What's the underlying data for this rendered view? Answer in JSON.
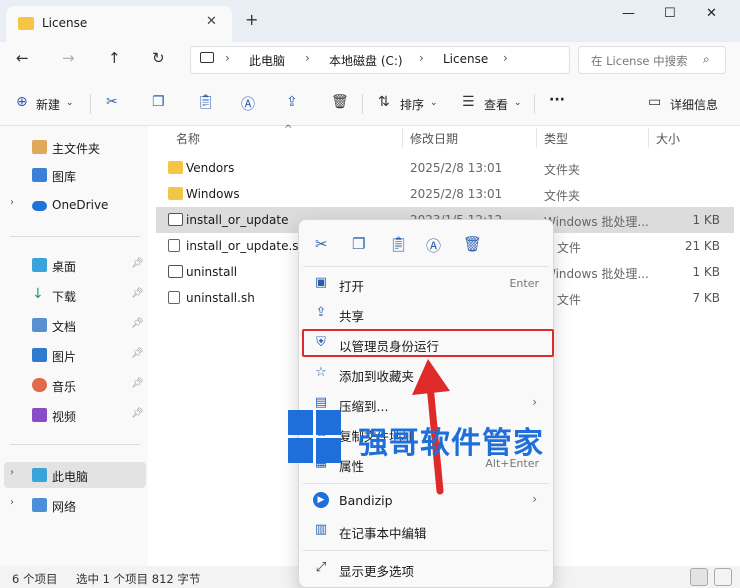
{
  "window": {
    "tab_title": "License",
    "tab_close": "✕",
    "new_tab": "+",
    "minimize": "—",
    "maximize": "☐",
    "close": "✕"
  },
  "nav": {
    "back": "←",
    "forward": "→",
    "up": "↑",
    "refresh": "↻",
    "breadcrumb": [
      "此电脑",
      "本地磁盘 (C:)",
      "License"
    ],
    "search_placeholder": "在 License 中搜索"
  },
  "toolbar": {
    "new_label": "新建",
    "sort_label": "排序",
    "view_label": "查看",
    "more": "···",
    "details_label": "详细信息"
  },
  "sidebar": {
    "items": [
      {
        "label": "主文件夹",
        "icon": "home-icon"
      },
      {
        "label": "图库",
        "icon": "gallery-icon"
      },
      {
        "label": "OneDrive",
        "icon": "cloud-icon"
      },
      {
        "label": "桌面",
        "icon": "desktop-icon"
      },
      {
        "label": "下载",
        "icon": "download-icon"
      },
      {
        "label": "文档",
        "icon": "document-icon"
      },
      {
        "label": "图片",
        "icon": "picture-icon"
      },
      {
        "label": "音乐",
        "icon": "music-icon"
      },
      {
        "label": "视频",
        "icon": "video-icon"
      },
      {
        "label": "此电脑",
        "icon": "computer-icon"
      },
      {
        "label": "网络",
        "icon": "network-icon"
      }
    ]
  },
  "columns": {
    "name": "名称",
    "date": "修改日期",
    "type": "类型",
    "size": "大小"
  },
  "files": [
    {
      "name": "Vendors",
      "date": "2025/2/8 13:01",
      "type": "文件夹",
      "size": ""
    },
    {
      "name": "Windows",
      "date": "2025/2/8 13:01",
      "type": "文件夹",
      "size": ""
    },
    {
      "name": "install_or_update",
      "date": "2023/1/5 12:12",
      "type": "Windows 批处理...",
      "size": "1 KB"
    },
    {
      "name": "install_or_update.sh",
      "date": "",
      "type": "H 文件",
      "size": "21 KB"
    },
    {
      "name": "uninstall",
      "date": "",
      "type": "Windows 批处理...",
      "size": "1 KB"
    },
    {
      "name": "uninstall.sh",
      "date": "",
      "type": "H 文件",
      "size": "7 KB"
    }
  ],
  "context_menu": {
    "items": [
      {
        "label": "打开",
        "key": "Enter",
        "icon": "open-icon"
      },
      {
        "label": "共享",
        "key": "",
        "icon": "share-icon"
      },
      {
        "label": "以管理员身份运行",
        "key": "",
        "icon": "shield-icon"
      },
      {
        "label": "添加到收藏夹",
        "key": "",
        "icon": "star-icon"
      },
      {
        "label": "压缩到...",
        "key": "",
        "icon": "zip-icon"
      },
      {
        "label": "复制文件地址",
        "key": "",
        "icon": "copy-path-icon"
      },
      {
        "label": "属性",
        "key": "Alt+Enter",
        "icon": "properties-icon"
      },
      {
        "label": "Bandizip",
        "key": "",
        "icon": "bandizip-icon"
      },
      {
        "label": "在记事本中编辑",
        "key": "",
        "icon": "notepad-icon"
      },
      {
        "label": "显示更多选项",
        "key": "",
        "icon": "more-options-icon"
      }
    ]
  },
  "watermark": "强哥软件管家",
  "status": {
    "count": "6 个项目",
    "selection": "选中 1 个项目 812 字节"
  },
  "colors": {
    "accent": "#2b5fae",
    "highlight": "#e02a2a",
    "folder": "#f5c545"
  }
}
